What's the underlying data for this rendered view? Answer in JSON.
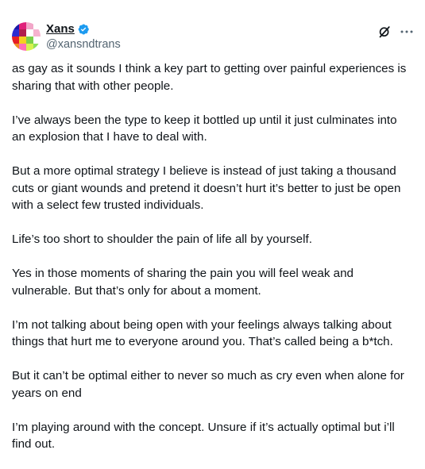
{
  "author": {
    "display_name": "Xans",
    "handle": "@xansndtrans",
    "verified_icon": "verified-badge-icon",
    "avatar_colors": [
      "#1a1aa8",
      "#e0207a",
      "#f2a6c8",
      "#ffffff",
      "#2b2bd1",
      "#b01e4e",
      "#ffffff",
      "#f6b3cf",
      "#e51d25",
      "#f5d020",
      "#7ad14a",
      "#ffffff",
      "#f08a24",
      "#ff6fb5",
      "#d7f24e",
      "#8fe05a"
    ]
  },
  "actions": {
    "grok_icon": "grok-icon",
    "more_icon": "more-horizontal-icon"
  },
  "paragraphs": [
    "as gay as it sounds I think a key part to getting over painful experiences is sharing that with other people.",
    "I’ve always been the type to keep it bottled up until it just culminates into an explosion that I have to deal with.",
    "But a more optimal strategy I believe is instead of just taking a thousand cuts or giant wounds and pretend it doesn’t hurt it’s better to just be open with a select few trusted individuals.",
    "Life’s too short to shoulder the pain of life all by yourself.",
    "Yes in those moments of sharing the pain you will feel weak and vulnerable. But that’s only for about a moment.",
    "I’m not talking about being open with your feelings always talking about things that hurt me to everyone around you. That’s called being a b*tch.",
    "But it can’t be optimal either to never so much as cry even when alone for years on end",
    "I’m playing around with the concept. Unsure if it’s actually optimal but i’ll find out."
  ]
}
